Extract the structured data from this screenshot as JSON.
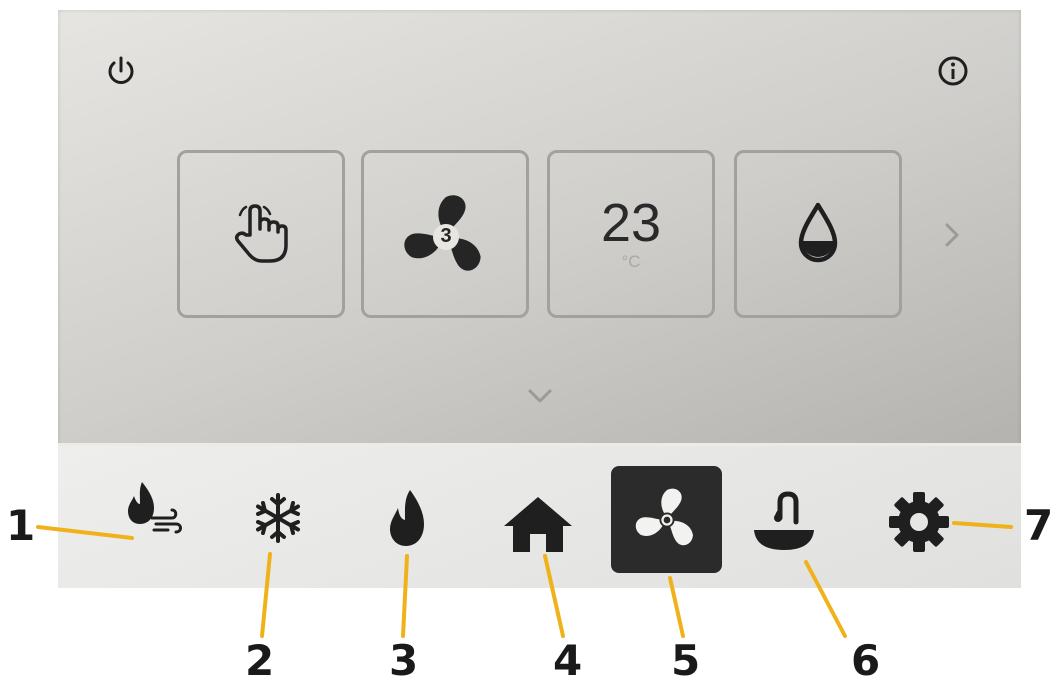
{
  "screen": {
    "top_bar": {
      "power_icon": "power-icon",
      "info_icon": "info-icon"
    },
    "tiles": [
      {
        "id": "mode",
        "icon": "hand-pointer-icon"
      },
      {
        "id": "fan-speed",
        "icon": "fan-icon",
        "badge": "3"
      },
      {
        "id": "temperature",
        "value": "23",
        "unit": "°C"
      },
      {
        "id": "humidity",
        "icon": "water-drop-icon"
      }
    ],
    "next_icon": "chevron-right-icon",
    "expand_icon": "chevron-down-icon"
  },
  "navbar": {
    "items": [
      {
        "id": "heat-ventilation",
        "icon": "flame-wind-icon",
        "active": false
      },
      {
        "id": "cooling",
        "icon": "snowflake-icon",
        "active": false
      },
      {
        "id": "heating",
        "icon": "flame-icon",
        "active": false
      },
      {
        "id": "home",
        "icon": "home-icon",
        "active": false
      },
      {
        "id": "fan",
        "icon": "fan-icon",
        "active": true
      },
      {
        "id": "hot-water",
        "icon": "faucet-bowl-icon",
        "active": false
      },
      {
        "id": "settings",
        "icon": "gear-icon",
        "active": false
      }
    ]
  },
  "callouts": [
    "1",
    "2",
    "3",
    "4",
    "5",
    "6",
    "7"
  ],
  "colors": {
    "callout_line": "#f0b21a",
    "active_bg": "#2b2b2b",
    "icon": "#2a2a2a"
  }
}
